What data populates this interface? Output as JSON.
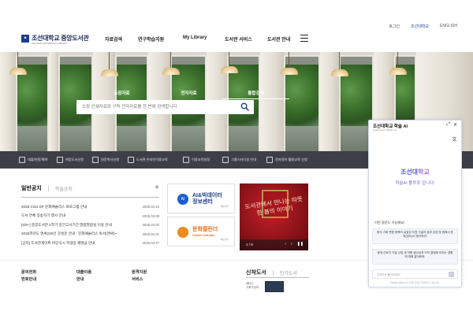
{
  "utility": {
    "login": "로그인",
    "site": "조선대학교",
    "lang": "ENGLISH"
  },
  "logo": {
    "name": "조선대학교 중앙도서관",
    "sub": "CHOSUN UNIVERSITY LIBRARY"
  },
  "gnb": [
    "자료검색",
    "연구학습지원",
    "My Library",
    "도서관 서비스",
    "도서관 안내"
  ],
  "search": {
    "tabs": [
      "소장자료",
      "전자자료",
      "통합검색"
    ],
    "placeholder": "소장 인쇄자료와 구독 전자자료를 한 번에 검색합니다."
  },
  "quick": [
    "대출/연장/예약",
    "희망도서신청",
    "원문복사신청",
    "도서관 온라인이용교육",
    "이용교육일정",
    "그룹스터디실 안내",
    "전자정보 활용교육 신청"
  ],
  "notice": {
    "tab_active": "일반공지",
    "tab_inactive": "학술공지",
    "items": [
      {
        "title": "2025 CSU-SP 문화예술리스 프로그램 안내",
        "date": "2025.04.10"
      },
      {
        "title": "도서 연체 장송하기 행사 안내",
        "date": "2025.04.09"
      },
      {
        "title": "[4/9~] 중앙도서관 1학기 중간고사기간 열람열람실 이용 안내",
        "date": "2025.04.02"
      },
      {
        "title": "2025학년도 앤써100선 강성문 안내 : 문화예술리스 독서(앤써)~",
        "date": "2025.03.31"
      },
      {
        "title": "[공지] 도서관게이트 비인식시 학생증 재발급 안내",
        "date": "2025.03.27"
      }
    ]
  },
  "banners": {
    "ai": {
      "line1": "AI&빅데이터",
      "line2": "정보센터",
      "more": "바로가기"
    },
    "culture": {
      "line1": "문화캘린더",
      "line2": "Culture Calendar",
      "more": "바로가기"
    }
  },
  "poster": {
    "text": "도서관에서 만나는 따뜻한 봄의 이야기",
    "count": "1 / 8"
  },
  "bottom": [
    {
      "l1": "문의전화",
      "l2": "번호안내"
    },
    {
      "l1": "대출이용",
      "l2": "안내"
    },
    {
      "l1": "원격지원",
      "l2": "서비스"
    }
  ],
  "newbooks": {
    "active": "신착도서",
    "inactive": "인기도서",
    "desc1": "(확인)",
    "desc2": "기획구성의 ..."
  },
  "chat": {
    "title": "조선대학교 학술 AI",
    "powered": "powered by  Wander.ai",
    "brand_a": "조선대",
    "brand_b": "학교",
    "sub": "학술AI 툴루포 입니다!",
    "q_title": "이런 질문도 가능해요!",
    "q1": "청각 기록 변환 정책의 실효성 지표 기술의 효과 갖성 및 앱에서 표과(정도)이 평가하라.",
    "q2": "청색 근로자 기술 산업 내 직원 생산성과 조직 결정에 미치는 영향에 대해 알아봐줘.",
    "input": "무엇이든 물어보세요!",
    "foot": "Wander.ai에서 AI가 보유한 답변은 부정확 할 수 있습니다"
  }
}
